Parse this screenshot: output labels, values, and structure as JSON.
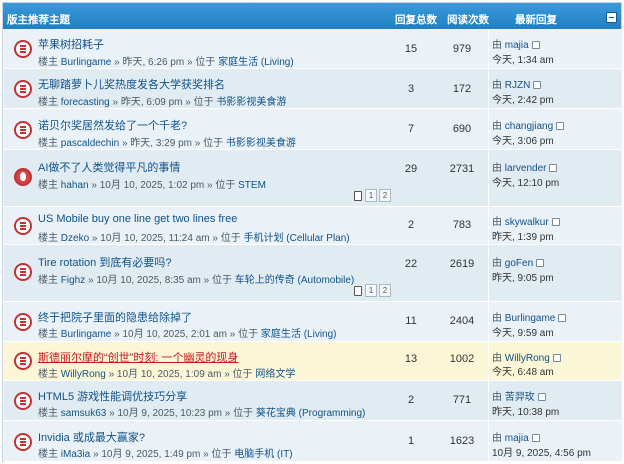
{
  "header": {
    "title": "版主推荐主题",
    "replies": "回复总数",
    "views": "阅读次数",
    "last": "最新回复"
  },
  "topics": [
    {
      "title": "苹果树招耗子",
      "by": "楼主",
      "author": "Burlingame",
      "time": "» 昨天, 6:26 pm » 位于",
      "forum": "家庭生活 (Living)",
      "replies": "15",
      "views": "979",
      "last_by_prefix": "由",
      "last_user": "majia",
      "last_time": "今天, 1:34 am"
    },
    {
      "title": "无聊踏萝卜儿奖热度发各大学获奖排名",
      "by": "楼主",
      "author": "forecasting",
      "time": "» 昨天, 6:09 pm » 位于",
      "forum": "书影影视美食游",
      "replies": "3",
      "views": "172",
      "last_by_prefix": "由",
      "last_user": "RJZN",
      "last_time": "今天, 2:42 pm"
    },
    {
      "title": "诺贝尔奖居然发给了一个千老?",
      "by": "楼主",
      "author": "pascaldechin",
      "time": "» 昨天, 3:29 pm » 位于",
      "forum": "书影影视美食游",
      "replies": "7",
      "views": "690",
      "last_by_prefix": "由",
      "last_user": "changjiang",
      "last_time": "今天, 3:06 pm"
    },
    {
      "title": "AI做不了人类觉得平凡的事情",
      "by": "楼主",
      "author": "hahan",
      "time": "» 10月 10, 2025, 1:02 pm » 位于",
      "forum": "STEM",
      "replies": "29",
      "views": "2731",
      "last_by_prefix": "由",
      "last_user": "larvender",
      "last_time": "今天, 12:10 pm",
      "pages": [
        "1",
        "2"
      ]
    },
    {
      "title": "US Mobile buy one line get two lines free",
      "by": "楼主",
      "author": "Dzeko",
      "time": "» 10月 10, 2025, 11:24 am » 位于",
      "forum": "手机计划 (Cellular Plan)",
      "replies": "2",
      "views": "783",
      "last_by_prefix": "由",
      "last_user": "skywalkur",
      "last_time": "昨天, 1:39 pm"
    },
    {
      "title": "Tire rotation 到底有必要吗?",
      "by": "楼主",
      "author": "Fighz",
      "time": "» 10月 10, 2025, 8:35 am » 位于",
      "forum": "车轮上的传奇 (Automobile)",
      "replies": "22",
      "views": "2619",
      "last_by_prefix": "由",
      "last_user": "goFen",
      "last_time": "昨天, 9:05 pm",
      "pages": [
        "1",
        "2"
      ]
    },
    {
      "title": "终于把院子里面的隐患给除掉了",
      "by": "楼主",
      "author": "Burlingame",
      "time": "» 10月 10, 2025, 2:01 am » 位于",
      "forum": "家庭生活 (Living)",
      "replies": "11",
      "views": "2404",
      "last_by_prefix": "由",
      "last_user": "Burlingame",
      "last_time": "今天, 9:59 am"
    },
    {
      "title": "斯德丽尔摩的“创世”时刻: 一个幽灵的现身",
      "by": "楼主",
      "author": "WillyRong",
      "time": "» 10月 10, 2025, 1:09 am » 位于",
      "forum": "网络文学",
      "replies": "13",
      "views": "1002",
      "last_by_prefix": "由",
      "last_user": "WillyRong",
      "last_time": "今天, 6:48 am"
    },
    {
      "title": "HTML5 游戏性能调优技巧分享",
      "by": "楼主",
      "author": "samsuk63",
      "time": "» 10月 9, 2025, 10:23 pm » 位于",
      "forum": "葵花宝典 (Programming)",
      "replies": "2",
      "views": "771",
      "last_by_prefix": "由",
      "last_user": "苦羿玫",
      "last_time": "昨天, 10:38 pm"
    },
    {
      "title": "Invidia 或成最大赢家?",
      "by": "楼主",
      "author": "iMa3ia",
      "time": "» 10月 9, 2025, 1:49 pm » 位于",
      "forum": "电脑手机 (IT)",
      "replies": "1",
      "views": "1623",
      "last_by_prefix": "由",
      "last_user": "majia",
      "last_time": "10月 9, 2025, 4:56 pm"
    }
  ],
  "colors": {
    "header": "#2a8bd0",
    "row": "#eaf2f8",
    "sticky": "#fbf6d6",
    "link": "#105289",
    "icon": "#c33232"
  },
  "icons": {
    "topic": "topic-read-icon",
    "hot": "topic-hot-icon",
    "goto": "goto-last-post-icon",
    "pages": "pages-icon"
  }
}
